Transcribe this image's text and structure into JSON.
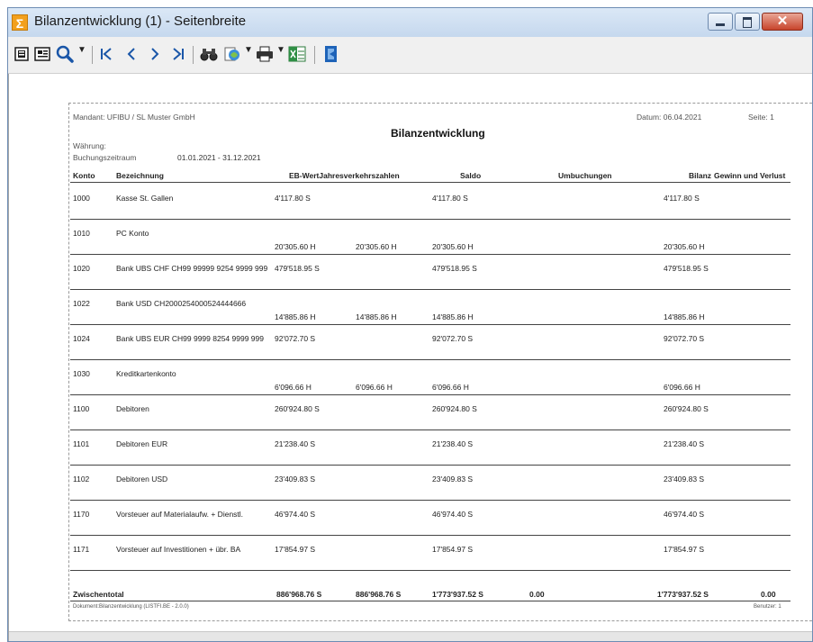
{
  "window": {
    "title": "Bilanzentwicklung (1) - Seitenbreite",
    "app_icon_glyph": "Σ",
    "close_glyph": "✕"
  },
  "toolbar": {
    "icons": [
      "page-view-icon",
      "preview-icon",
      "zoom-icon",
      "first-page-icon",
      "prev-page-icon",
      "next-page-icon",
      "last-page-icon",
      "find-icon",
      "export-icon",
      "print-icon",
      "excel-icon",
      "exit-icon"
    ]
  },
  "report": {
    "mandant": "Mandant: UFIBU / SL Muster GmbH",
    "datum": "Datum: 06.04.2021",
    "seite": "Seite: 1",
    "title": "Bilanzentwicklung",
    "waehrung": "Währung:",
    "buchungszeitraum_label": "Buchungszeitraum",
    "buchungszeitraum_value": "01.01.2021 - 31.12.2021",
    "columns": {
      "konto": "Konto",
      "bezeichnung": "Bezeichnung",
      "ebwert_jvz": "EB-WertJahresverkehrszahlen",
      "saldo": "Saldo",
      "umbuchungen": "Umbuchungen",
      "bilanz": "Bilanz",
      "gewinn_verlust": "Gewinn und Verlust"
    },
    "rows": [
      {
        "konto": "1000",
        "bez": "Kasse St. Gallen",
        "eb": "4'117.80  S",
        "jvz": "",
        "saldo": "4'117.80  S",
        "bilanz": "4'117.80  S",
        "split": false
      },
      {
        "konto": "1010",
        "bez": "PC Konto",
        "eb": "20'305.60  H",
        "jvz": "20'305.60  H",
        "saldo": "20'305.60  H",
        "bilanz": "20'305.60  H",
        "split": true
      },
      {
        "konto": "1020",
        "bez": "Bank UBS CHF CH99 99999 9254 9999 999",
        "eb": "479'518.95  S",
        "jvz": "",
        "saldo": "479'518.95  S",
        "bilanz": "479'518.95  S",
        "split": false
      },
      {
        "konto": "1022",
        "bez": "Bank USD CH2000254000524444666",
        "eb": "14'885.86  H",
        "jvz": "14'885.86  H",
        "saldo": "14'885.86  H",
        "bilanz": "14'885.86  H",
        "split": true
      },
      {
        "konto": "1024",
        "bez": "Bank UBS EUR CH99 9999  8254 9999 999",
        "eb": "92'072.70  S",
        "jvz": "",
        "saldo": "92'072.70  S",
        "bilanz": "92'072.70  S",
        "split": false
      },
      {
        "konto": "1030",
        "bez": "Kreditkartenkonto",
        "eb": "6'096.66  H",
        "jvz": "6'096.66  H",
        "saldo": "6'096.66  H",
        "bilanz": "6'096.66  H",
        "split": true
      },
      {
        "konto": "1100",
        "bez": "Debitoren",
        "eb": "260'924.80  S",
        "jvz": "",
        "saldo": "260'924.80  S",
        "bilanz": "260'924.80  S",
        "split": false
      },
      {
        "konto": "1101",
        "bez": "Debitoren EUR",
        "eb": "21'238.40  S",
        "jvz": "",
        "saldo": "21'238.40  S",
        "bilanz": "21'238.40  S",
        "split": false
      },
      {
        "konto": "1102",
        "bez": "Debitoren USD",
        "eb": "23'409.83  S",
        "jvz": "",
        "saldo": "23'409.83  S",
        "bilanz": "23'409.83  S",
        "split": false
      },
      {
        "konto": "1170",
        "bez": "Vorsteuer auf Materialaufw. + Dienstl.",
        "eb": "46'974.40  S",
        "jvz": "",
        "saldo": "46'974.40  S",
        "bilanz": "46'974.40  S",
        "split": false
      },
      {
        "konto": "1171",
        "bez": "Vorsteuer auf Investitionen + übr. BA",
        "eb": "17'854.97  S",
        "jvz": "",
        "saldo": "17'854.97  S",
        "bilanz": "17'854.97  S",
        "split": false
      }
    ],
    "zwischentotal": {
      "label": "Zwischentotal",
      "eb": "886'968.76  S",
      "jvz": "886'968.76  S",
      "saldo": "1'773'937.52  S",
      "umbuchungen": "0.00",
      "bilanz": "1'773'937.52  S",
      "gewinn_verlust": "0.00"
    },
    "footer_left": "Dokument:Bilanzentwicklung (LISTFI.BE - 2.0.0)",
    "footer_right": "Benutzer: 1"
  }
}
